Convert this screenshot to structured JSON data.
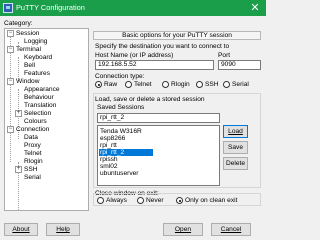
{
  "window": {
    "title": "PuTTY Configuration",
    "close_glyph": "✕"
  },
  "category": {
    "label": "Category:",
    "items": [
      {
        "label": "Session",
        "expanded": true
      },
      {
        "label": "Logging"
      },
      {
        "label": "Terminal",
        "expanded": true
      },
      {
        "label": "Keyboard"
      },
      {
        "label": "Bell"
      },
      {
        "label": "Features"
      },
      {
        "label": "Window",
        "expanded": true
      },
      {
        "label": "Appearance"
      },
      {
        "label": "Behaviour"
      },
      {
        "label": "Translation"
      },
      {
        "label": "Selection",
        "expanded": false
      },
      {
        "label": "Colours"
      },
      {
        "label": "Connection",
        "expanded": true
      },
      {
        "label": "Data"
      },
      {
        "label": "Proxy"
      },
      {
        "label": "Telnet"
      },
      {
        "label": "Rlogin"
      },
      {
        "label": "SSH",
        "expanded": false
      },
      {
        "label": "Serial"
      }
    ]
  },
  "session": {
    "header": "Basic options for your PuTTY session",
    "destination_label": "Specify the destination you want to connect to",
    "host_label": "Host Name (or IP address)",
    "host_value": "192.168.5.52",
    "port_label": "Port",
    "port_value": "9090",
    "connection_type_label": "Connection type:",
    "connection_types": [
      "Raw",
      "Telnet",
      "Rlogin",
      "SSH",
      "Serial"
    ],
    "connection_type_selected": "Raw",
    "load_save_label": "Load, save or delete a stored session",
    "saved_sessions_label": "Saved Sessions",
    "saved_session_value": "rpi_rtt_2",
    "sessions_list": [
      "Tenda W316R",
      "esp8266",
      "rpi_rtt",
      "rpi_rtt_2",
      "rpissh",
      "sml02",
      "ubuntuserver"
    ],
    "selected_session": "rpi_rtt_2",
    "load_button": "Load",
    "save_button": "Save",
    "delete_button": "Delete",
    "close_on_exit_label": "Close window on exit:",
    "close_options": [
      "Always",
      "Never",
      "Only on clean exit"
    ],
    "close_selected": "Only on clean exit"
  },
  "footer": {
    "about_button": "About",
    "help_button": "Help",
    "open_button": "Open",
    "cancel_button": "Cancel"
  },
  "colors": {
    "titlebar": "#1a9e4a",
    "selection": "#0078d7"
  }
}
